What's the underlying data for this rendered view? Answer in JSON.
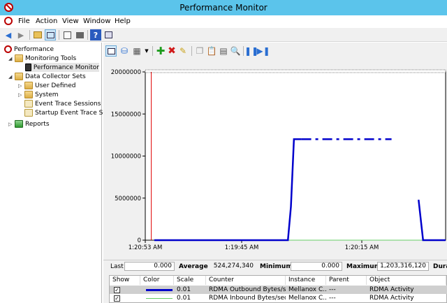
{
  "window": {
    "title": "Performance Monitor"
  },
  "menu": [
    "File",
    "Action",
    "View",
    "Window",
    "Help"
  ],
  "tree": {
    "root": "Performance",
    "monitoring_tools": "Monitoring Tools",
    "performance_monitor": "Performance Monitor",
    "data_collector_sets": "Data Collector Sets",
    "user_defined": "User Defined",
    "system": "System",
    "event_trace_sessions": "Event Trace Sessions",
    "startup_event_trace": "Startup Event Trace Ses",
    "reports": "Reports"
  },
  "chart_data": {
    "type": "line",
    "y_ticks": [
      "20000000",
      "15000000",
      "10000000",
      "5000000",
      "0"
    ],
    "ylim": [
      0,
      20000000
    ],
    "x_ticks": [
      "1:20:53 AM",
      "1:19:45 AM",
      "1:20:15 AM"
    ],
    "x_range_seconds": [
      0,
      100
    ],
    "current_time_bar_seconds": 2,
    "series": [
      {
        "color": "#0000cc",
        "style": "solid+dash",
        "points": [
          [
            3,
            0
          ],
          [
            47.5,
            0
          ],
          [
            48.5,
            4000000
          ],
          [
            49.5,
            12000000
          ],
          [
            82,
            12000000
          ]
        ],
        "points2": [
          [
            91,
            4800000
          ],
          [
            92.5,
            0
          ],
          [
            100,
            0
          ]
        ],
        "dashed_from": 52
      },
      {
        "color": "#66cc66",
        "style": "solid",
        "points": [
          [
            3,
            0
          ],
          [
            100,
            0
          ]
        ]
      }
    ]
  },
  "stats": {
    "last_label": "Last",
    "last_value": "0.000",
    "average_label": "Average",
    "average_value": "524,274,340",
    "minimum_label": "Minimum",
    "minimum_value": "0.000",
    "maximum_label": "Maximum",
    "maximum_value": "1,203,316,120",
    "duration_label": "Dura"
  },
  "table": {
    "headers": [
      "Show",
      "Color",
      "Scale",
      "Counter",
      "Instance",
      "Parent",
      "Object"
    ],
    "rows": [
      {
        "show": "✓",
        "color": "#0000cc",
        "scale": "0.01",
        "counter": "RDMA Outbound Bytes/sec",
        "instance": "Mellanox C...",
        "parent": "---",
        "object": "RDMA Activity"
      },
      {
        "show": "✓",
        "color": "#66cc66",
        "scale": "0.01",
        "counter": "RDMA Inbound Bytes/sec",
        "instance": "Mellanox C...",
        "parent": "---",
        "object": "RDMA Activity"
      }
    ]
  }
}
